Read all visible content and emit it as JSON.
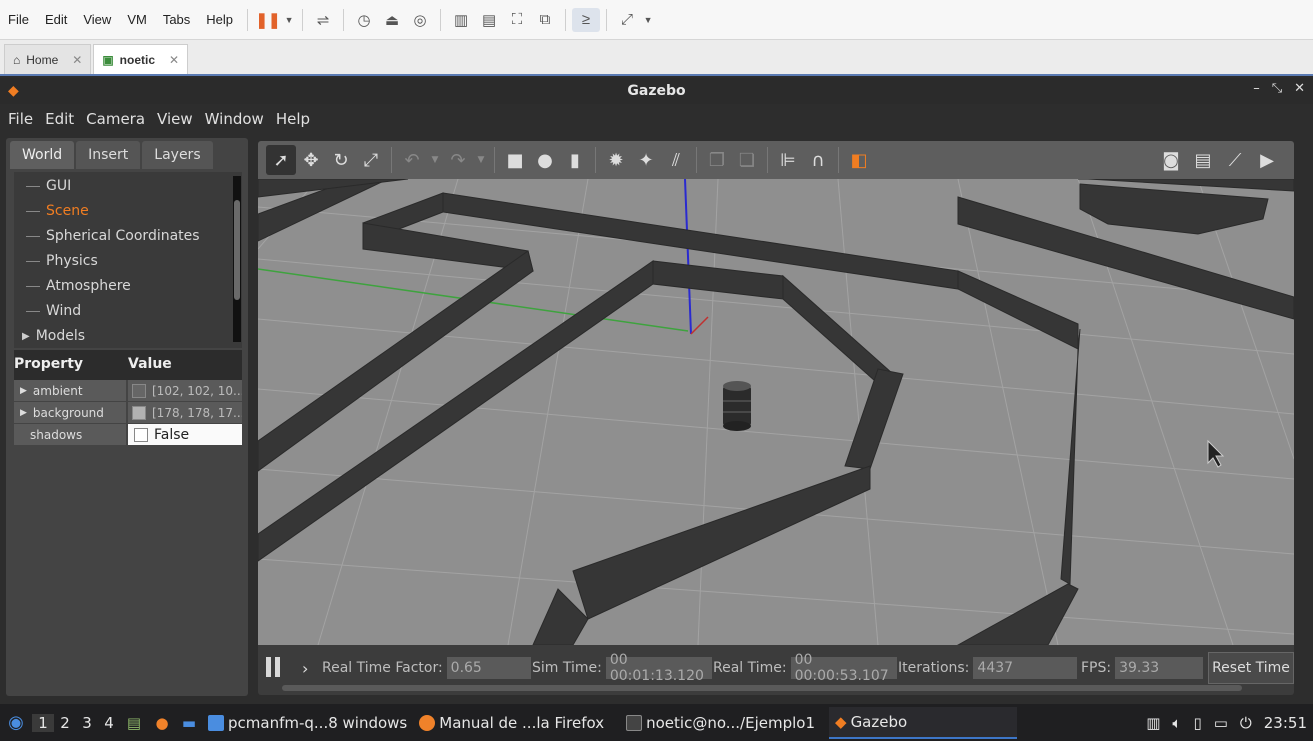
{
  "vm": {
    "menu": [
      "File",
      "Edit",
      "View",
      "VM",
      "Tabs",
      "Help"
    ],
    "tabs": [
      {
        "label": "Home",
        "active": false
      },
      {
        "label": "noetic",
        "active": true
      }
    ]
  },
  "gazebo": {
    "title": "Gazebo",
    "menu": [
      "File",
      "Edit",
      "Camera",
      "View",
      "Window",
      "Help"
    ],
    "panel_tabs": [
      "World",
      "Insert",
      "Layers"
    ],
    "tree": [
      {
        "label": "GUI",
        "selected": false,
        "expandable": false
      },
      {
        "label": "Scene",
        "selected": true,
        "expandable": false
      },
      {
        "label": "Spherical Coordinates",
        "selected": false,
        "expandable": false
      },
      {
        "label": "Physics",
        "selected": false,
        "expandable": false
      },
      {
        "label": "Atmosphere",
        "selected": false,
        "expandable": false
      },
      {
        "label": "Wind",
        "selected": false,
        "expandable": false
      },
      {
        "label": "Models",
        "selected": false,
        "expandable": true
      }
    ],
    "properties": {
      "header_property": "Property",
      "header_value": "Value",
      "rows": [
        {
          "key": "ambient",
          "value": "[102, 102, 10...",
          "swatch": "#666666"
        },
        {
          "key": "background",
          "value": "[178, 178, 17...",
          "swatch": "#b2b2b2"
        },
        {
          "key": "shadows",
          "value": "False",
          "checked": false
        }
      ]
    },
    "sim": {
      "real_time_factor_label": "Real Time Factor:",
      "real_time_factor": "0.65",
      "sim_time_label": "Sim Time:",
      "sim_time": "00 00:01:13.120",
      "real_time_label": "Real Time:",
      "real_time": "00 00:00:53.107",
      "iterations_label": "Iterations:",
      "iterations": "4437",
      "fps_label": "FPS:",
      "fps": "39.33",
      "reset_label": "Reset Time"
    },
    "accent_color": "#f07d22"
  },
  "taskbar": {
    "workspaces": [
      "1",
      "2",
      "3",
      "4"
    ],
    "tasks": [
      {
        "label": "pcmanfm-q...8 windows",
        "icon": "folder-icon"
      },
      {
        "label": "Manual de ...la Firefox",
        "icon": "firefox-icon"
      },
      {
        "label": "noetic@no.../Ejemplo1",
        "icon": "terminal-icon"
      },
      {
        "label": "Gazebo",
        "icon": "gazebo-icon",
        "active": true
      }
    ],
    "clock": "23:51"
  }
}
